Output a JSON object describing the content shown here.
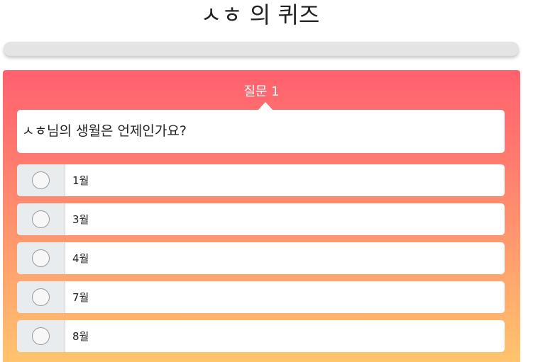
{
  "quiz": {
    "title": "ㅅㅎ 의 퀴즈",
    "progress": 0
  },
  "question": {
    "label": "질문 1",
    "text": "ㅅㅎ님의 생월은 언제인가요?",
    "options": [
      {
        "label": "1월"
      },
      {
        "label": "3월"
      },
      {
        "label": "4월"
      },
      {
        "label": "7월"
      },
      {
        "label": "8월"
      }
    ]
  },
  "colors": {
    "card_gradient_top": "#ff616e",
    "card_gradient_bottom": "#ffc46d",
    "progress_track": "#e4e4e4",
    "radio_cell": "#e9ecef"
  }
}
